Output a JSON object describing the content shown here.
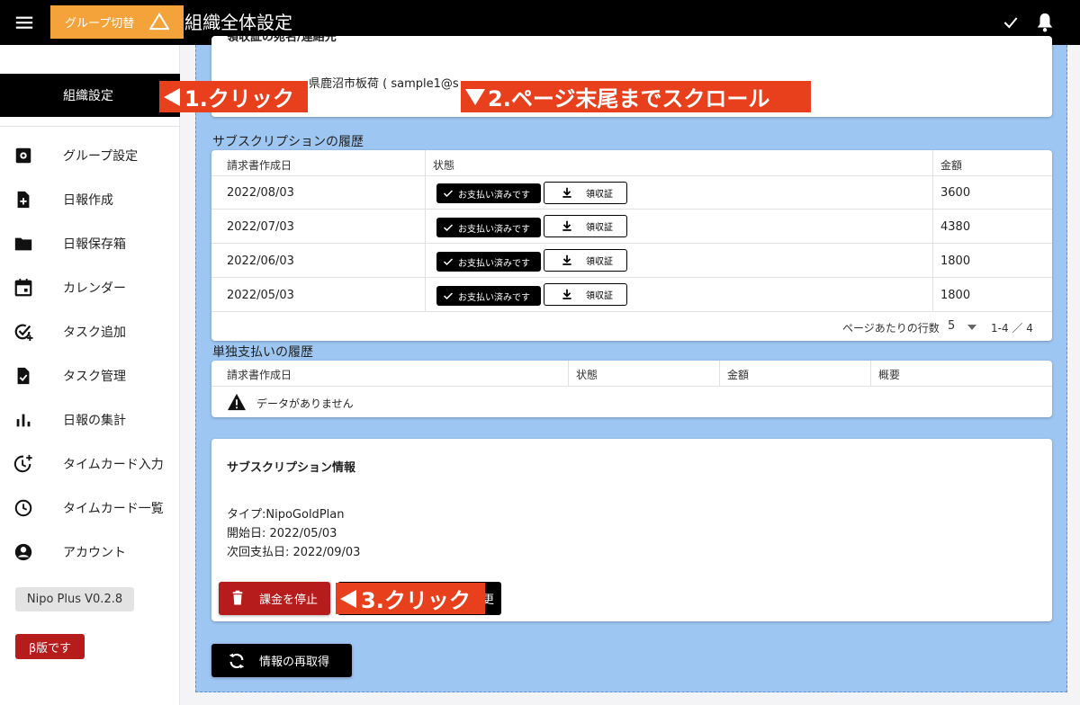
{
  "header": {
    "group_switch_label": "グループ切替",
    "title": "組織全体設定"
  },
  "sidebar": {
    "selected_label": "組織設定",
    "items": [
      {
        "label": "グループ設定",
        "icon": "settings-icon"
      },
      {
        "label": "日報作成",
        "icon": "note-add-icon"
      },
      {
        "label": "日報保存箱",
        "icon": "folder-icon"
      },
      {
        "label": "カレンダー",
        "icon": "calendar-icon"
      },
      {
        "label": "タスク追加",
        "icon": "task-add-icon"
      },
      {
        "label": "タスク管理",
        "icon": "task-file-icon"
      },
      {
        "label": "日報の集計",
        "icon": "bar-chart-icon"
      },
      {
        "label": "タイムカード入力",
        "icon": "clock-add-icon"
      },
      {
        "label": "タイムカード一覧",
        "icon": "clock-icon"
      },
      {
        "label": "アカウント",
        "icon": "account-icon"
      }
    ],
    "version": "Nipo Plus V0.2.8",
    "beta": "β版です"
  },
  "top_card": {
    "cut_title": "領収証の宛名/連絡先",
    "address": "県鹿沼市板荷 ( sample1@s"
  },
  "subscription_history": {
    "title": "サブスクリプションの履歴",
    "columns": [
      "請求書作成日",
      "状態",
      "金額"
    ],
    "rows": [
      {
        "date": "2022/08/03",
        "status": "お支払い済みです",
        "receipt": "領収証",
        "amount": "3600"
      },
      {
        "date": "2022/07/03",
        "status": "お支払い済みです",
        "receipt": "領収証",
        "amount": "4380"
      },
      {
        "date": "2022/06/03",
        "status": "お支払い済みです",
        "receipt": "領収証",
        "amount": "1800"
      },
      {
        "date": "2022/05/03",
        "status": "お支払い済みです",
        "receipt": "領収証",
        "amount": "1800"
      }
    ],
    "rows_per_page_label": "ページあたりの行数",
    "rows_per_page_value": "5",
    "page_range": "1-4 ／ 4"
  },
  "single_payment_history": {
    "title": "単独支払いの履歴",
    "columns": [
      "請求書作成日",
      "状態",
      "金額",
      "概要"
    ],
    "empty_text": "データがありません"
  },
  "subscription_info": {
    "title": "サブスクリプション情報",
    "type_line": "タイプ:NipoGoldPlan",
    "start_line": "開始日: 2022/05/03",
    "next_line": "次回支払日: 2022/09/03",
    "stop_button": "課金を停止",
    "change_button_visible": "更"
  },
  "refetch_button": "情報の再取得",
  "annotations": {
    "step1": "1.クリック",
    "step2": "2.ページ末尾までスクロール",
    "step3": "3.クリック",
    "color": "#e8401c"
  }
}
